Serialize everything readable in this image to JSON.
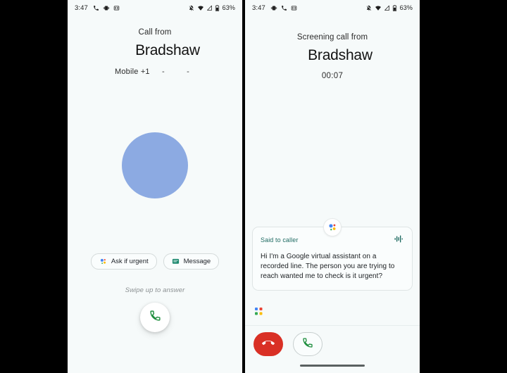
{
  "colors": {
    "screen_bg": "#F6FAFA",
    "avatar": "#8CAAE2",
    "answer_green": "#1E8E3E",
    "end_red": "#D93025",
    "bubble_title": "#1F6B63",
    "waveform": "#17655C",
    "assistant_blue": "#4285F4",
    "assistant_red": "#EA4335",
    "assistant_yellow": "#FBBC04",
    "assistant_green": "#34A853"
  },
  "left_screen": {
    "name": "incoming-call-screen",
    "statusbar": {
      "time": "3:47",
      "left_icons": [
        "phone-call-icon",
        "vibrate-icon",
        "sim-card-icon"
      ],
      "right_icons": [
        "notifications-muted-icon",
        "wifi-icon",
        "cellular-signal-icon",
        "battery-icon"
      ],
      "battery_percent": "63%"
    },
    "label": "Call from",
    "caller_name": "Bradshaw",
    "number_prefix": "Mobile +1",
    "number_dash_1": "-",
    "number_dash_2": "-",
    "chips": [
      {
        "label": "Ask if urgent",
        "icon": "google-assistant-icon"
      },
      {
        "label": "Message",
        "icon": "message-icon"
      }
    ],
    "swipe_hint": "Swipe up to answer",
    "answer_button": {
      "name": "answer-call-button",
      "icon": "phone-icon"
    }
  },
  "right_screen": {
    "name": "call-screening-screen",
    "statusbar": {
      "time": "3:47",
      "left_icons": [
        "vibrate-icon",
        "phone-call-icon",
        "sim-card-icon"
      ],
      "right_icons": [
        "notifications-muted-icon",
        "wifi-icon",
        "cellular-signal-icon",
        "battery-icon"
      ],
      "battery_percent": "63%"
    },
    "label": "Screening call from",
    "caller_name": "Bradshaw",
    "timer": "00:07",
    "transcript": {
      "badge_icon": "google-assistant-icon",
      "title": "Said to caller",
      "waveform_icon": "audio-waveform-icon",
      "text": "Hi I'm a Google virtual assistant on a recorded line. The person you are trying to reach wanted me to check is it urgent?"
    },
    "listening_indicator": "google-assistant-dots-icon",
    "controls": [
      {
        "name": "end-call-button",
        "icon": "phone-hangup-icon"
      },
      {
        "name": "answer-call-button",
        "icon": "phone-icon"
      }
    ],
    "nav_pill": "gesture-navigation-pill"
  }
}
